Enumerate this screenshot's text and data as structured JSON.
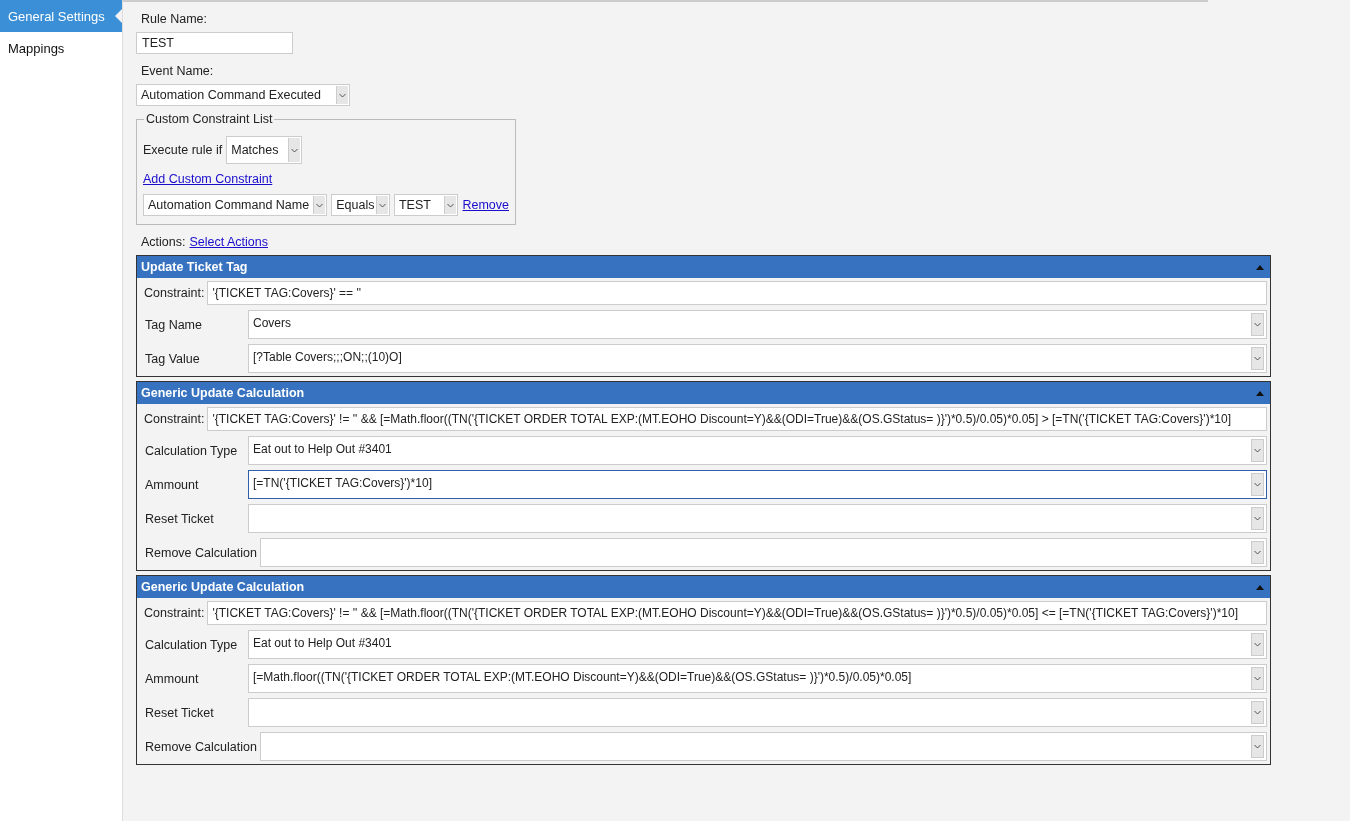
{
  "sidebar": {
    "items": [
      {
        "label": "General Settings",
        "selected": true
      },
      {
        "label": "Mappings",
        "selected": false
      }
    ]
  },
  "rule_name": {
    "label": "Rule Name:",
    "value": "TEST"
  },
  "event_name": {
    "label": "Event Name:",
    "value": "Automation Command Executed"
  },
  "constraint_list": {
    "legend": "Custom Constraint List",
    "execute_label": "Execute rule if",
    "execute_value": "Matches",
    "add_link": "Add Custom Constraint",
    "rows": [
      {
        "name": "Automation Command Name",
        "operator": "Equals",
        "value": "TEST",
        "remove": "Remove"
      }
    ]
  },
  "actions": {
    "label": "Actions:",
    "link": "Select Actions"
  },
  "action_panels": [
    {
      "title": "Update Ticket Tag",
      "expanded": true,
      "constraint_label": "Constraint:",
      "constraint": "'{TICKET TAG:Covers}' == ''",
      "fields": [
        {
          "label": "Tag Name",
          "value": "Covers",
          "focused": false
        },
        {
          "label": "Tag Value",
          "value": "[?Table Covers;;;ON;;(10)O]",
          "focused": false
        }
      ]
    },
    {
      "title": "Generic Update Calculation",
      "expanded": true,
      "constraint_label": "Constraint:",
      "constraint": "'{TICKET TAG:Covers}' != '' && [=Math.floor((TN('{TICKET ORDER TOTAL EXP:(MT.EOHO Discount=Y)&&(ODI=True)&&(OS.GStatus= )}')*0.5)/0.05)*0.05] > [=TN('{TICKET TAG:Covers}')*10]",
      "fields": [
        {
          "label": "Calculation Type",
          "value": "Eat out to Help Out #3401",
          "focused": false
        },
        {
          "label": "Ammount",
          "value": "[=TN('{TICKET TAG:Covers}')*10]",
          "focused": true
        },
        {
          "label": "Reset Ticket",
          "focused": false
        },
        {
          "label": "Remove Calculation",
          "focused": false
        }
      ]
    },
    {
      "title": "Generic Update Calculation",
      "expanded": true,
      "constraint_label": "Constraint:",
      "constraint": "'{TICKET TAG:Covers}' != '' && [=Math.floor((TN('{TICKET ORDER TOTAL EXP:(MT.EOHO Discount=Y)&&(ODI=True)&&(OS.GStatus= )}')*0.5)/0.05)*0.05] <= [=TN('{TICKET TAG:Covers}')*10]",
      "fields": [
        {
          "label": "Calculation Type",
          "value": "Eat out to Help Out #3401",
          "focused": false
        },
        {
          "label": "Ammount",
          "value": "[=Math.floor((TN('{TICKET ORDER TOTAL EXP:(MT.EOHO Discount=Y)&&(ODI=True)&&(OS.GStatus= )}')*0.5)/0.05)*0.05]",
          "focused": false
        },
        {
          "label": "Reset Ticket",
          "focused": false
        },
        {
          "label": "Remove Calculation",
          "focused": false
        }
      ]
    }
  ]
}
